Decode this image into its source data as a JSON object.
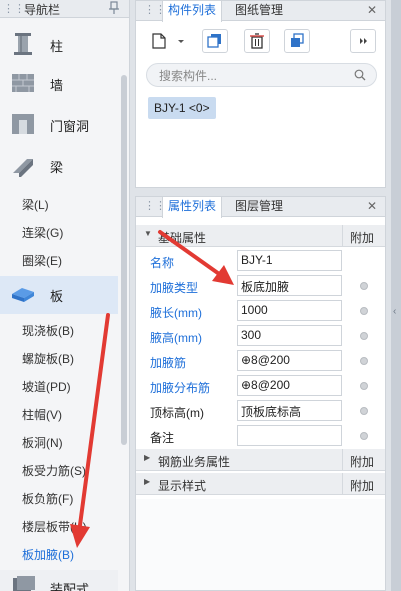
{
  "nav": {
    "title": "导航栏",
    "categories": [
      {
        "label": "柱",
        "icon": "column-icon"
      },
      {
        "label": "墙",
        "icon": "wall-icon"
      },
      {
        "label": "门窗洞",
        "icon": "door-window-icon"
      },
      {
        "label": "梁",
        "icon": "beam-icon"
      },
      {
        "label": "板",
        "icon": "slab-icon"
      },
      {
        "label": "装配式",
        "icon": "prefab-icon"
      }
    ],
    "beam_items": [
      "梁(L)",
      "连梁(G)",
      "圈梁(E)"
    ],
    "slab_items": [
      "现浇板(B)",
      "螺旋板(B)",
      "坡道(PD)",
      "柱帽(V)",
      "板洞(N)",
      "板受力筋(S)",
      "板负筋(F)",
      "楼层板带(H)",
      "板加腋(B)"
    ],
    "selected_item": "板加腋(B)"
  },
  "component_panel": {
    "tabs": [
      "构件列表",
      "图纸管理"
    ],
    "active_tab": "构件列表",
    "toolbar_icons": [
      "new-component-icon",
      "dropdown-arrow-icon",
      "copy-icon",
      "delete-icon",
      "layer-copy-icon",
      "expand-icon"
    ],
    "search_placeholder": "搜索构件...",
    "items": [
      "BJY-1 <0>"
    ]
  },
  "property_panel": {
    "tabs": [
      "属性列表",
      "图层管理"
    ],
    "active_tab": "属性列表",
    "sections": [
      {
        "title": "基础属性",
        "extra": "附加",
        "expanded": true
      },
      {
        "title": "钢筋业务属性",
        "extra": "附加",
        "expanded": false
      },
      {
        "title": "显示样式",
        "extra": "附加",
        "expanded": false
      }
    ],
    "rows": [
      {
        "name": "名称",
        "value": "BJY-1",
        "blue": true,
        "checkbox": false
      },
      {
        "name": "加腋类型",
        "value": "板底加腋",
        "blue": true,
        "checkbox": true
      },
      {
        "name": "腋长(mm)",
        "value": "1000",
        "blue": true,
        "checkbox": true
      },
      {
        "name": "腋高(mm)",
        "value": "300",
        "blue": true,
        "checkbox": true
      },
      {
        "name": "加腋筋",
        "value": "⊕8@200",
        "blue": true,
        "checkbox": true
      },
      {
        "name": "加腋分布筋",
        "value": "⊕8@200",
        "blue": true,
        "checkbox": true
      },
      {
        "name": "顶标高(m)",
        "value": "顶板底标高",
        "blue": false,
        "checkbox": true
      },
      {
        "name": "备注",
        "value": "",
        "blue": false,
        "checkbox": true
      }
    ]
  },
  "colors": {
    "accent": "#1e6fd9",
    "annotation_arrow": "#e23a33",
    "selection_chip": "#c9dbf0"
  }
}
